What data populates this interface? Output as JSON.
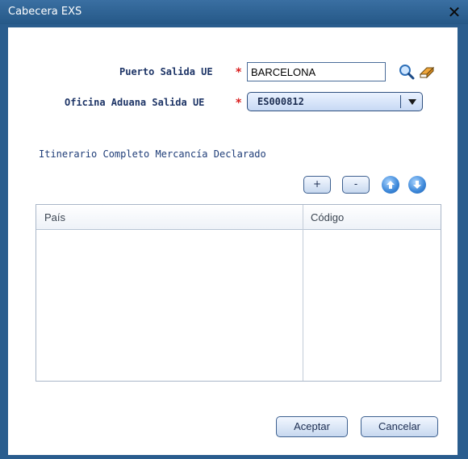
{
  "window": {
    "title": "Cabecera EXS"
  },
  "form": {
    "puerto_label": "Puerto Salida UE",
    "puerto_value": "BARCELONA",
    "oficina_label": "Oficina Aduana Salida UE",
    "oficina_value": "ES000812",
    "required_mark": "*"
  },
  "itinerary": {
    "title": "Itinerario Completo Mercancía Declarado",
    "add_label": "+",
    "remove_label": "-",
    "columns": [
      "País",
      "Código"
    ]
  },
  "footer": {
    "accept_label": "Aceptar",
    "cancel_label": "Cancelar"
  },
  "colors": {
    "accent": "#2a5d8e",
    "required": "#d91d1d"
  }
}
